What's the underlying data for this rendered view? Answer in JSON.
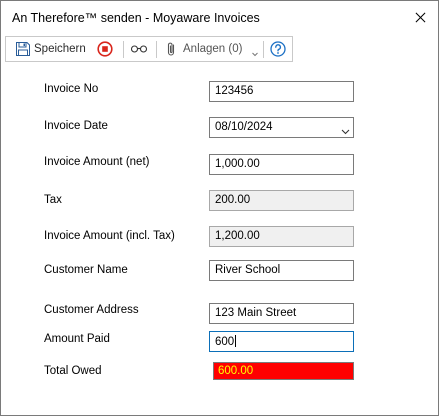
{
  "window": {
    "title": "An Therefore™ senden - Moyaware Invoices"
  },
  "toolbar": {
    "save_label": "Speichern",
    "attachments_label": "Anlagen (0)"
  },
  "icons": {
    "save": "save-icon",
    "stop": "stop-icon",
    "glasses": "glasses-icon",
    "paperclip": "paperclip-icon",
    "dropdown": "chevron-down-icon",
    "help": "help-icon",
    "close": "close-icon"
  },
  "colors": {
    "accent": "#1a6fc4",
    "stop": "#d9261c",
    "alert_bg": "#ff0000",
    "alert_text": "#ffff00",
    "focus_border": "#0b6fb8"
  },
  "form": {
    "invoice_no": {
      "label": "Invoice No",
      "value": "123456"
    },
    "invoice_date": {
      "label": "Invoice Date",
      "value": "08/10/2024"
    },
    "invoice_amount_net": {
      "label": "Invoice Amount (net)",
      "value": "1,000.00"
    },
    "tax": {
      "label": "Tax",
      "value": "200.00"
    },
    "invoice_amount_incl_tax": {
      "label": "Invoice Amount (incl. Tax)",
      "value": "1,200.00"
    },
    "customer_name": {
      "label": "Customer Name",
      "value": "River School"
    },
    "customer_address": {
      "label": "Customer Address",
      "value": "123 Main Street"
    },
    "amount_paid": {
      "label": "Amount Paid",
      "value": "600"
    },
    "total_owed": {
      "label": "Total Owed",
      "value": "600.00"
    }
  }
}
